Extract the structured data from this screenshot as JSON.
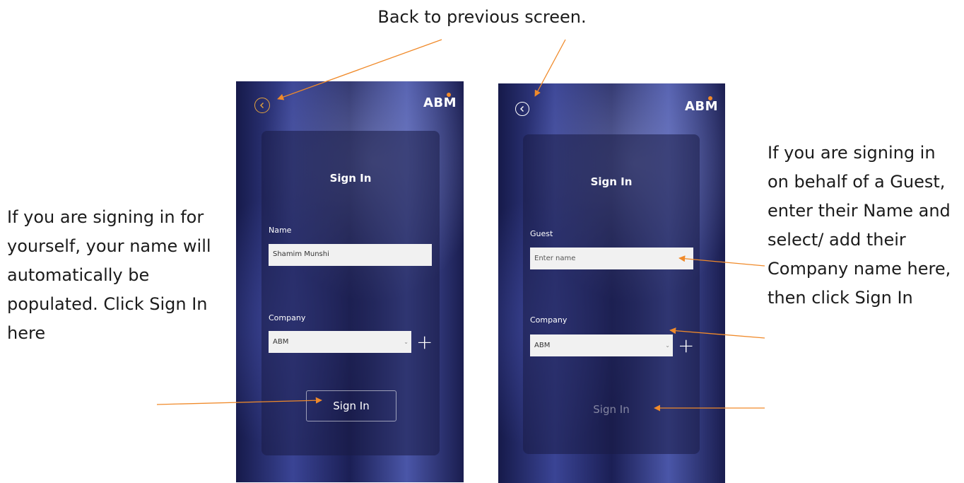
{
  "annotations": {
    "top": "Back to previous screen.",
    "left": "If you are signing in for yourself, your name will automatically be populated. Click Sign In here",
    "right": "If you are signing in on behalf of a Guest, enter their Name and select/ add their Company name here, then click Sign In"
  },
  "colors": {
    "accent": "#f08a2a",
    "back_highlight": "#e5a33d"
  },
  "screens": [
    {
      "logo": "ABM",
      "title": "Sign In",
      "name_label": "Name",
      "name_value": "Shamim Munshi",
      "company_label": "Company",
      "company_value": "ABM",
      "sign_in_label": "Sign In"
    },
    {
      "logo": "ABM",
      "title": "Sign In",
      "guest_label": "Guest",
      "guest_placeholder": "Enter name",
      "company_label": "Company",
      "company_value": "ABM",
      "sign_in_label": "Sign In"
    }
  ]
}
